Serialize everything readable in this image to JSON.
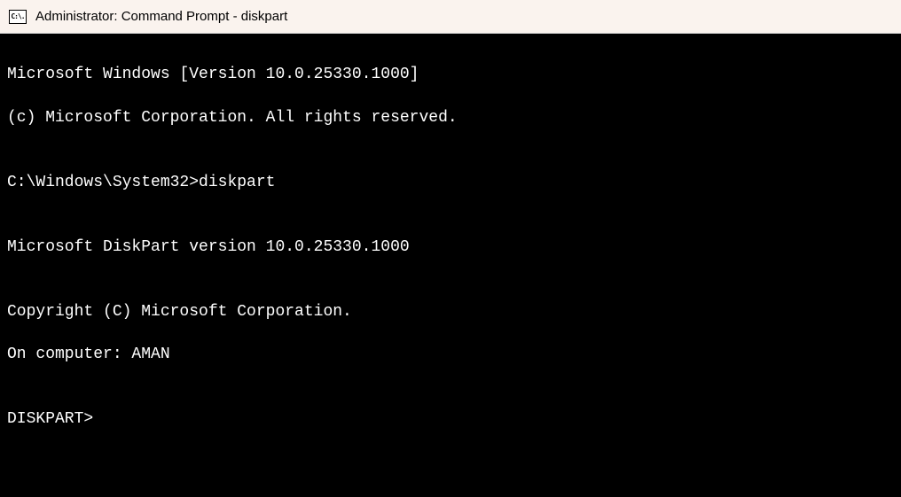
{
  "titlebar": {
    "icon_text": "C:\\.",
    "title": "Administrator: Command Prompt - diskpart"
  },
  "terminal": {
    "line1": "Microsoft Windows [Version 10.0.25330.1000]",
    "line2": "(c) Microsoft Corporation. All rights reserved.",
    "blank1": "",
    "line3": "C:\\Windows\\System32>diskpart",
    "blank2": "",
    "line4": "Microsoft DiskPart version 10.0.25330.1000",
    "blank3": "",
    "line5": "Copyright (C) Microsoft Corporation.",
    "line6": "On computer: AMAN",
    "blank4": "",
    "line7": "DISKPART>"
  }
}
